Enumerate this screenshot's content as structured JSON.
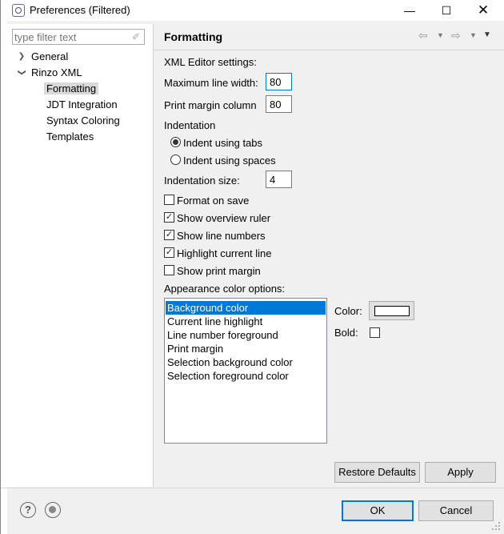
{
  "window": {
    "title": "Preferences (Filtered)",
    "minimize_glyph": "—",
    "maximize_glyph": "☐",
    "close_glyph": "✕"
  },
  "filter": {
    "placeholder": "type filter text"
  },
  "tree": {
    "items": [
      {
        "label": "General",
        "expanded": false
      },
      {
        "label": "Rinzo XML",
        "expanded": true
      },
      {
        "label": "Formatting",
        "selected": true
      },
      {
        "label": "JDT Integration"
      },
      {
        "label": "Syntax Coloring"
      },
      {
        "label": "Templates"
      }
    ]
  },
  "page": {
    "title": "Formatting",
    "xml_editor_settings": "XML Editor settings:",
    "max_line_width_label": "Maximum line width:",
    "max_line_width_value": "80",
    "print_margin_label": "Print margin column",
    "print_margin_value": "80",
    "indentation_heading": "Indentation",
    "indent_tabs_label": "Indent using tabs",
    "indent_spaces_label": "Indent using spaces",
    "indent_mode": "tabs",
    "indentation_size_label": "Indentation size:",
    "indentation_size_value": "4",
    "checkboxes": [
      {
        "label": "Format on save",
        "checked": false
      },
      {
        "label": "Show overview ruler",
        "checked": true
      },
      {
        "label": "Show line numbers",
        "checked": true
      },
      {
        "label": "Highlight current line",
        "checked": true
      },
      {
        "label": "Show print margin",
        "checked": false
      }
    ],
    "appearance_heading": "Appearance color options:",
    "color_options": [
      "Background color",
      "Current line highlight",
      "Line number foreground",
      "Print margin",
      "Selection background color",
      "Selection foreground color"
    ],
    "selected_color_option": "Background color",
    "color_label": "Color:",
    "color_value": "#ffffff",
    "bold_label": "Bold:",
    "bold_checked": false,
    "restore_defaults_label": "Restore Defaults",
    "apply_label": "Apply"
  },
  "footer": {
    "ok_label": "OK",
    "cancel_label": "Cancel",
    "help_icon_glyph": "?"
  },
  "colors": {
    "selection_blue": "#0078d7",
    "tree_selection": "#d9d9d9",
    "dialog_bg": "#f0f0f0"
  }
}
